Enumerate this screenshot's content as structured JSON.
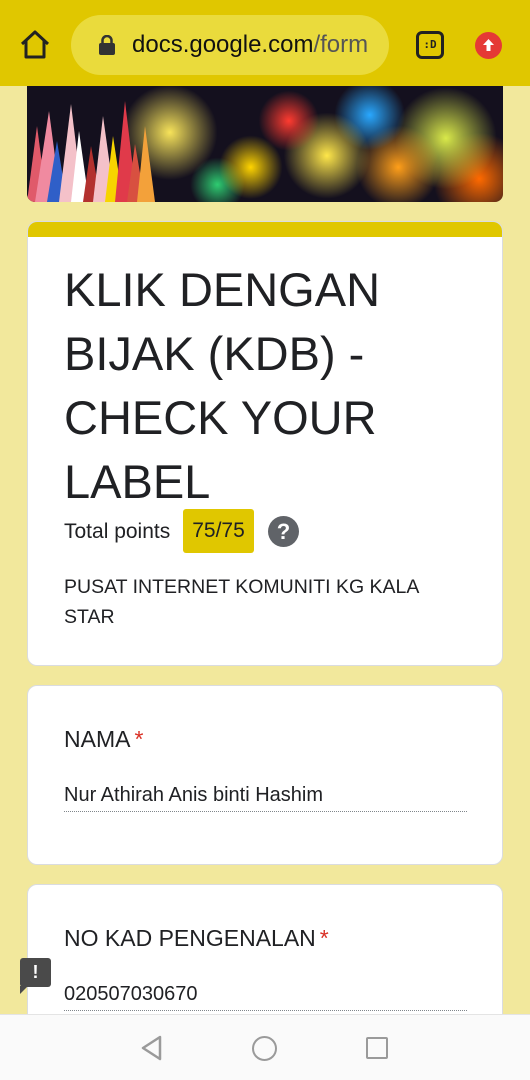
{
  "browser": {
    "url_host": "docs.google.com",
    "url_path": "/form",
    "tabs_label": ":D",
    "icons": [
      "home-icon",
      "lock-icon",
      "tabs-icon",
      "update-arrow-icon"
    ],
    "colors": {
      "toolbar": "#e0c700",
      "urlbox": "#eadb3c",
      "update": "#e53935"
    }
  },
  "form": {
    "title": "KLIK DENGAN BIJAK (KDB) - CHECK YOUR LABEL",
    "points_label": "Total points",
    "points_value": "75/75",
    "description": "PUSAT INTERNET KOMUNITI KG KALA STAR",
    "accent_color": "#e0c700"
  },
  "questions": [
    {
      "label": "NAMA",
      "required_mark": "*",
      "answer": "Nur Athirah Anis binti Hashim"
    },
    {
      "label": "NO KAD PENGENALAN",
      "required_mark": "*",
      "answer": "020507030670"
    }
  ],
  "feedback": {
    "label": "!"
  },
  "navbar": {
    "icons": [
      "back-icon",
      "home-circle-icon",
      "recents-icon"
    ]
  }
}
